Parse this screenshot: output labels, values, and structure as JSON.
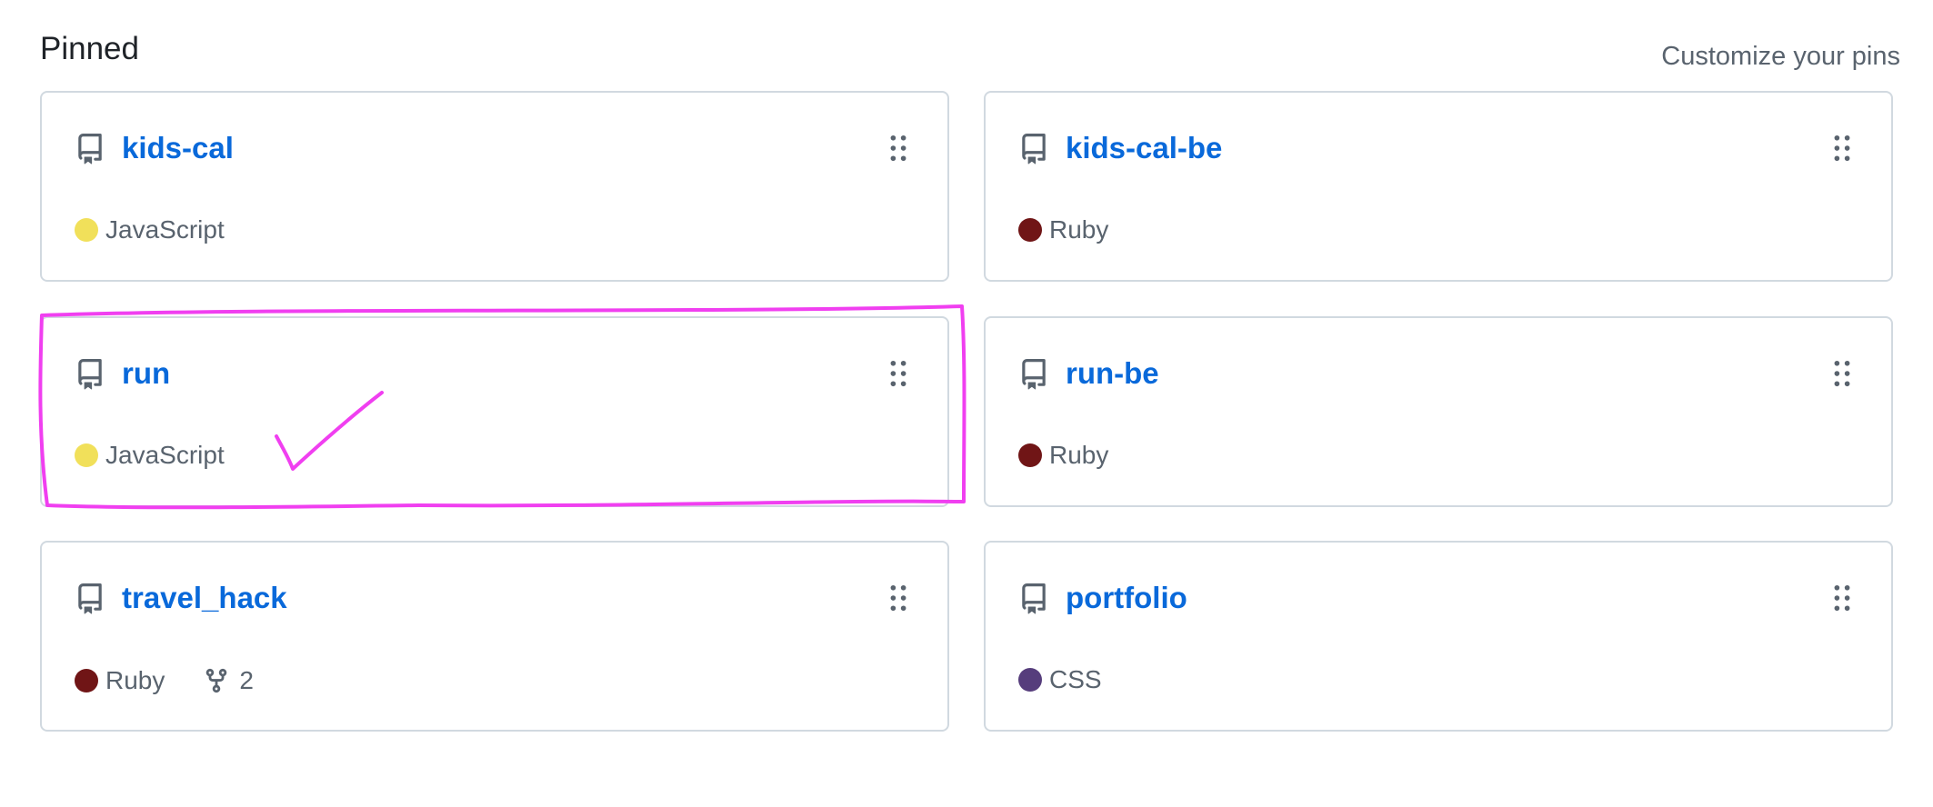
{
  "header": {
    "title": "Pinned",
    "customize_label": "Customize your pins"
  },
  "pins": [
    {
      "name": "kids-cal",
      "language": "JavaScript",
      "lang_color": "#f1e05a",
      "icon": "repo-icon"
    },
    {
      "name": "kids-cal-be",
      "language": "Ruby",
      "lang_color": "#701516",
      "icon": "repo-icon"
    },
    {
      "name": "run",
      "language": "JavaScript",
      "lang_color": "#f1e05a",
      "icon": "repo-icon"
    },
    {
      "name": "run-be",
      "language": "Ruby",
      "lang_color": "#701516",
      "icon": "repo-icon"
    },
    {
      "name": "travel_hack",
      "language": "Ruby",
      "lang_color": "#701516",
      "forks": "2",
      "icon": "repo-icon"
    },
    {
      "name": "portfolio",
      "language": "CSS",
      "lang_color": "#563d7c",
      "icon": "repo-icon"
    }
  ],
  "annotation": {
    "color": "#f03ff0",
    "marks": [
      "highlight-box",
      "check-mark"
    ]
  }
}
